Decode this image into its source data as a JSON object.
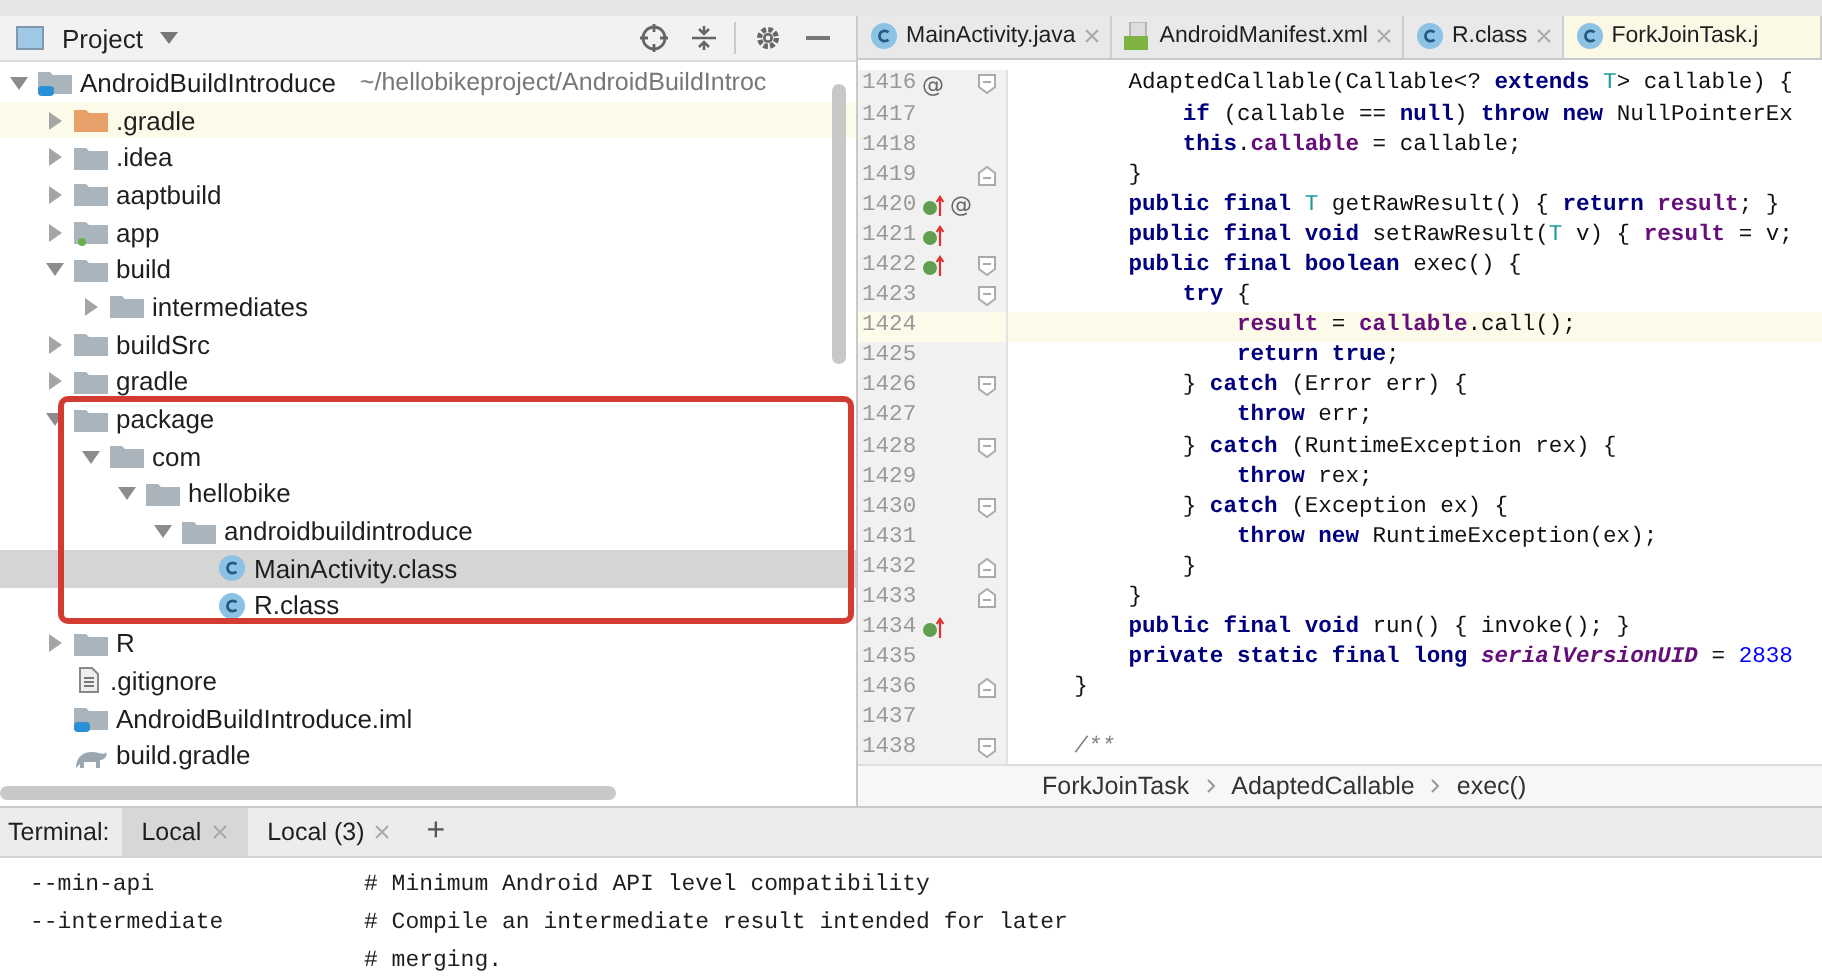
{
  "project_panel": {
    "title": "Project",
    "tree": [
      {
        "label": "AndroidBuildIntroduce",
        "path": "~/hellobikeproject/AndroidBuildIntroc",
        "kind": "module",
        "expanded": true,
        "selected": false,
        "children": [
          {
            "label": ".gradle",
            "kind": "excluded_folder",
            "expanded": false,
            "selected": false
          },
          {
            "label": ".idea",
            "kind": "folder",
            "expanded": false,
            "selected": false
          },
          {
            "label": "aaptbuild",
            "kind": "folder",
            "expanded": false,
            "selected": false
          },
          {
            "label": "app",
            "kind": "app_module",
            "expanded": false,
            "selected": false
          },
          {
            "label": "build",
            "kind": "folder",
            "expanded": true,
            "selected": false,
            "children": [
              {
                "label": "intermediates",
                "kind": "folder",
                "expanded": false,
                "selected": false
              }
            ]
          },
          {
            "label": "buildSrc",
            "kind": "folder",
            "expanded": false,
            "selected": false
          },
          {
            "label": "gradle",
            "kind": "folder",
            "expanded": false,
            "selected": false
          },
          {
            "label": "package",
            "kind": "folder",
            "expanded": true,
            "selected": false,
            "children": [
              {
                "label": "com",
                "kind": "folder",
                "expanded": true,
                "selected": false,
                "children": [
                  {
                    "label": "hellobike",
                    "kind": "folder",
                    "expanded": true,
                    "selected": false,
                    "children": [
                      {
                        "label": "androidbuildintroduce",
                        "kind": "folder",
                        "expanded": true,
                        "selected": false,
                        "children": [
                          {
                            "label": "MainActivity.class",
                            "kind": "class",
                            "selected": true
                          },
                          {
                            "label": "R.class",
                            "kind": "class",
                            "selected": false
                          }
                        ]
                      }
                    ]
                  }
                ]
              }
            ]
          },
          {
            "label": "R",
            "kind": "folder",
            "expanded": false,
            "selected": false
          },
          {
            "label": ".gitignore",
            "kind": "text_file",
            "selected": false
          },
          {
            "label": "AndroidBuildIntroduce.iml",
            "kind": "module",
            "selected": false
          },
          {
            "label": "build.gradle",
            "kind": "gradle",
            "selected": false
          }
        ]
      }
    ]
  },
  "editor": {
    "tabs": [
      {
        "label": "MainActivity.java",
        "kind": "class",
        "selected": false,
        "closable": true
      },
      {
        "label": "AndroidManifest.xml",
        "kind": "manifest",
        "selected": false,
        "closable": true
      },
      {
        "label": "R.class",
        "kind": "class",
        "selected": false,
        "closable": true
      },
      {
        "label": "ForkJoinTask.j",
        "kind": "class",
        "selected": true,
        "closable": false
      }
    ],
    "lines": [
      {
        "number": "1416",
        "badge": "@",
        "implements": false,
        "fold_open": true,
        "fold_close": false,
        "current": false,
        "tokens": [
          {
            "kind": "plain",
            "t": "        AdaptedCallable(Callable<? "
          },
          {
            "kind": "kw",
            "t": "extends"
          },
          {
            "kind": "type",
            "t": " T"
          },
          {
            "kind": "plain",
            "t": "> callable) {"
          }
        ]
      },
      {
        "number": "1417",
        "implements": false,
        "fold_open": false,
        "fold_close": false,
        "current": false,
        "tokens": [
          {
            "kind": "kw",
            "t": "            if"
          },
          {
            "kind": "plain",
            "t": " (callable == "
          },
          {
            "kind": "kw",
            "t": "null"
          },
          {
            "kind": "plain",
            "t": ") "
          },
          {
            "kind": "kw",
            "t": "throw new"
          },
          {
            "kind": "plain",
            "t": " NullPointerEx"
          }
        ]
      },
      {
        "number": "1418",
        "implements": false,
        "fold_open": false,
        "fold_close": false,
        "current": false,
        "tokens": [
          {
            "kind": "kw",
            "t": "            this"
          },
          {
            "kind": "plain",
            "t": "."
          },
          {
            "kind": "field",
            "t": "callable"
          },
          {
            "kind": "plain",
            "t": " = callable;"
          }
        ]
      },
      {
        "number": "1419",
        "implements": false,
        "fold_open": false,
        "fold_close": true,
        "current": false,
        "tokens": [
          {
            "kind": "plain",
            "t": "        }"
          }
        ]
      },
      {
        "number": "1420",
        "badge": "@",
        "implements": true,
        "fold_open": false,
        "fold_close": false,
        "current": false,
        "tokens": [
          {
            "kind": "kw",
            "t": "        public final"
          },
          {
            "kind": "type",
            "t": " T"
          },
          {
            "kind": "plain",
            "t": " getRawResult() { "
          },
          {
            "kind": "kw",
            "t": "return"
          },
          {
            "kind": "field",
            "t": " result"
          },
          {
            "kind": "plain",
            "t": "; }"
          }
        ]
      },
      {
        "number": "1421",
        "implements": true,
        "fold_open": false,
        "fold_close": false,
        "current": false,
        "tokens": [
          {
            "kind": "kw",
            "t": "        public final void"
          },
          {
            "kind": "plain",
            "t": " setRawResult("
          },
          {
            "kind": "type",
            "t": "T"
          },
          {
            "kind": "plain",
            "t": " v) { "
          },
          {
            "kind": "field",
            "t": "result"
          },
          {
            "kind": "plain",
            "t": " = v;"
          }
        ]
      },
      {
        "number": "1422",
        "implements": true,
        "fold_open": true,
        "fold_close": false,
        "current": false,
        "tokens": [
          {
            "kind": "kw",
            "t": "        public final boolean"
          },
          {
            "kind": "plain",
            "t": " exec() {"
          }
        ]
      },
      {
        "number": "1423",
        "implements": false,
        "fold_open": true,
        "fold_close": false,
        "current": false,
        "tokens": [
          {
            "kind": "kw",
            "t": "            try"
          },
          {
            "kind": "plain",
            "t": " {"
          }
        ]
      },
      {
        "number": "1424",
        "implements": false,
        "fold_open": false,
        "fold_close": false,
        "current": true,
        "tokens": [
          {
            "kind": "field",
            "t": "                result"
          },
          {
            "kind": "plain",
            "t": " = "
          },
          {
            "kind": "field",
            "t": "callable"
          },
          {
            "kind": "plain",
            "t": ".call();"
          }
        ]
      },
      {
        "number": "1425",
        "implements": false,
        "fold_open": false,
        "fold_close": false,
        "current": false,
        "tokens": [
          {
            "kind": "kw",
            "t": "                return true"
          },
          {
            "kind": "plain",
            "t": ";"
          }
        ]
      },
      {
        "number": "1426",
        "implements": false,
        "fold_open": true,
        "fold_close": false,
        "current": false,
        "tokens": [
          {
            "kind": "plain",
            "t": "            } "
          },
          {
            "kind": "kw",
            "t": "catch"
          },
          {
            "kind": "plain",
            "t": " (Error err) {"
          }
        ]
      },
      {
        "number": "1427",
        "implements": false,
        "fold_open": false,
        "fold_close": false,
        "current": false,
        "tokens": [
          {
            "kind": "kw",
            "t": "                throw"
          },
          {
            "kind": "plain",
            "t": " err;"
          }
        ]
      },
      {
        "number": "1428",
        "implements": false,
        "fold_open": true,
        "fold_close": false,
        "current": false,
        "tokens": [
          {
            "kind": "plain",
            "t": "            } "
          },
          {
            "kind": "kw",
            "t": "catch"
          },
          {
            "kind": "plain",
            "t": " (RuntimeException rex) {"
          }
        ]
      },
      {
        "number": "1429",
        "implements": false,
        "fold_open": false,
        "fold_close": false,
        "current": false,
        "tokens": [
          {
            "kind": "kw",
            "t": "                throw"
          },
          {
            "kind": "plain",
            "t": " rex;"
          }
        ]
      },
      {
        "number": "1430",
        "implements": false,
        "fold_open": true,
        "fold_close": false,
        "current": false,
        "tokens": [
          {
            "kind": "plain",
            "t": "            } "
          },
          {
            "kind": "kw",
            "t": "catch"
          },
          {
            "kind": "plain",
            "t": " (Exception ex) {"
          }
        ]
      },
      {
        "number": "1431",
        "implements": false,
        "fold_open": false,
        "fold_close": false,
        "current": false,
        "tokens": [
          {
            "kind": "kw",
            "t": "                throw new"
          },
          {
            "kind": "plain",
            "t": " RuntimeException(ex);"
          }
        ]
      },
      {
        "number": "1432",
        "implements": false,
        "fold_open": false,
        "fold_close": true,
        "current": false,
        "tokens": [
          {
            "kind": "plain",
            "t": "            }"
          }
        ]
      },
      {
        "number": "1433",
        "implements": false,
        "fold_open": false,
        "fold_close": true,
        "current": false,
        "tokens": [
          {
            "kind": "plain",
            "t": "        }"
          }
        ]
      },
      {
        "number": "1434",
        "implements": true,
        "fold_open": false,
        "fold_close": false,
        "current": false,
        "tokens": [
          {
            "kind": "kw",
            "t": "        public final void"
          },
          {
            "kind": "plain",
            "t": " run() { invoke(); }"
          }
        ]
      },
      {
        "number": "1435",
        "implements": false,
        "fold_open": false,
        "fold_close": false,
        "current": false,
        "tokens": [
          {
            "kind": "kw",
            "t": "        private static final long"
          },
          {
            "kind": "const",
            "t": " serialVersionUID"
          },
          {
            "kind": "plain",
            "t": " = "
          },
          {
            "kind": "num",
            "t": "2838"
          }
        ]
      },
      {
        "number": "1436",
        "implements": false,
        "fold_open": false,
        "fold_close": true,
        "current": false,
        "tokens": [
          {
            "kind": "plain",
            "t": "    }"
          }
        ]
      },
      {
        "number": "1437",
        "implements": false,
        "fold_open": false,
        "fold_close": false,
        "current": false
      },
      {
        "number": "1438",
        "implements": false,
        "fold_open": true,
        "fold_close": false,
        "current": false,
        "tokens": [
          {
            "kind": "comment",
            "t": "    /**"
          }
        ]
      }
    ],
    "breadcrumbs": [
      "ForkJoinTask",
      "AdaptedCallable",
      "exec()"
    ]
  },
  "terminal": {
    "label": "Terminal:",
    "tabs": [
      {
        "label": "Local",
        "selected": true
      },
      {
        "label": "Local (3)",
        "selected": false
      }
    ],
    "add": "+",
    "lines": [
      {
        "option": "--min-api",
        "comment": "# Minimum Android API level compatibility"
      },
      {
        "option": "--intermediate",
        "comment": "# Compile an intermediate result intended for later"
      },
      {
        "comment": "# merging."
      }
    ]
  }
}
